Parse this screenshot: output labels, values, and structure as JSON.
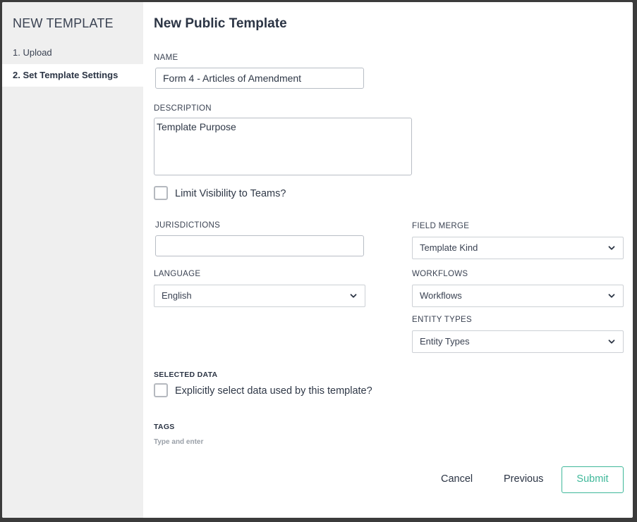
{
  "sidebar": {
    "title": "NEW TEMPLATE",
    "steps": [
      {
        "label": "1. Upload"
      },
      {
        "label": "2. Set Template Settings"
      }
    ]
  },
  "main": {
    "title": "New Public Template",
    "name": {
      "label": "NAME",
      "value": "Form 4 - Articles of Amendment"
    },
    "description": {
      "label": "DESCRIPTION",
      "value": "Template Purpose"
    },
    "limit_visibility": {
      "label": "Limit Visibility to Teams?",
      "checked": false
    },
    "jurisdictions": {
      "label": "JURISDICTIONS",
      "value": ""
    },
    "language": {
      "label": "LANGUAGE",
      "selected": "English"
    },
    "field_merge": {
      "label": "FIELD MERGE",
      "selected": "Template Kind"
    },
    "workflows": {
      "label": "WORKFLOWS",
      "selected": "Workflows"
    },
    "entity_types": {
      "label": "ENTITY TYPES",
      "selected": "Entity Types"
    },
    "selected_data": {
      "label": "SELECTED DATA",
      "checkbox_label": "Explicitly select data used by this template?",
      "checked": false
    },
    "tags": {
      "label": "TAGS",
      "placeholder": "Type and enter"
    }
  },
  "footer": {
    "cancel": "Cancel",
    "previous": "Previous",
    "submit": "Submit"
  },
  "colors": {
    "accent": "#3fb89a",
    "sidebar_bg": "#efefef",
    "text": "#2b3444"
  },
  "icons": {
    "select_arrow": "chevron-down-icon"
  }
}
